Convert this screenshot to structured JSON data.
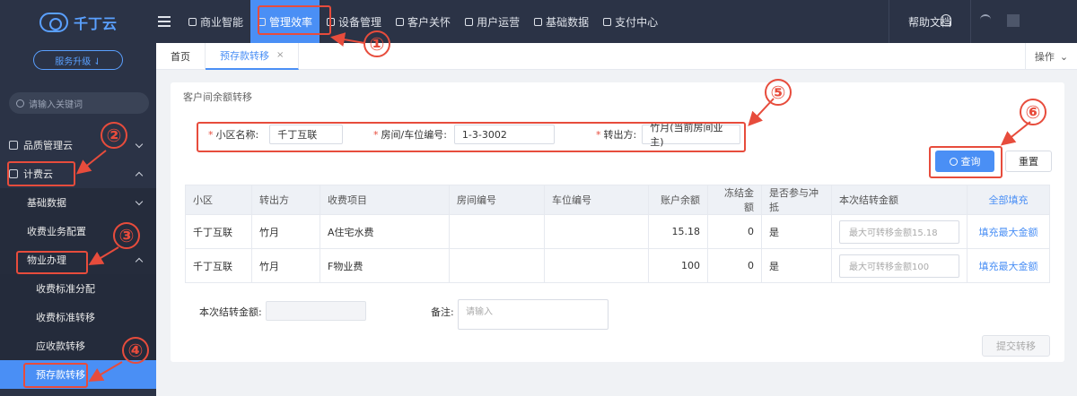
{
  "app": {
    "logo_text": "千丁云",
    "upgrade_label": "服务升级 ⇃"
  },
  "sidebar": {
    "search_placeholder": "请输入关键词",
    "items": [
      {
        "label": "品质管理云",
        "level": 1
      },
      {
        "label": "计费云",
        "level": 1
      },
      {
        "label": "基础数据",
        "level": 2
      },
      {
        "label": "收费业务配置",
        "level": 2
      },
      {
        "label": "物业办理",
        "level": 2
      },
      {
        "label": "收费标准分配",
        "level": 3
      },
      {
        "label": "收费标准转移",
        "level": 3
      },
      {
        "label": "应收款转移",
        "level": 3
      },
      {
        "label": "预存款转移",
        "level": 3,
        "active": true
      }
    ]
  },
  "topnav": {
    "items": [
      "商业智能",
      "管理效率",
      "设备管理",
      "客户关怀",
      "用户运营",
      "基础数据",
      "支付中心"
    ],
    "active": "管理效率",
    "help": "帮助文档"
  },
  "tabs": {
    "home": "首页",
    "current": "预存款转移",
    "close": "×",
    "ops": "操作"
  },
  "panel": {
    "title": "客户间余额转移",
    "form": {
      "community_label": "小区名称:",
      "community_value": "千丁互联",
      "room_label": "房间/车位编号:",
      "room_value": "1-3-3002",
      "from_label": "转出方:",
      "from_value": "竹月(当前房间业主)"
    },
    "query_label": "查询",
    "reset_label": "重置",
    "table": {
      "headers": [
        "小区",
        "转出方",
        "收费项目",
        "房间编号",
        "车位编号",
        "账户余额",
        "冻结金额",
        "是否参与冲抵",
        "本次结转金额",
        "全部填充"
      ],
      "rows": [
        [
          "千丁互联",
          "竹月",
          "A住宅水费",
          "",
          "",
          "15.18",
          "0",
          "是",
          "最大可转移金额15.18",
          "填充最大金额"
        ],
        [
          "千丁互联",
          "竹月",
          "F物业费",
          "",
          "",
          "100",
          "0",
          "是",
          "最大可转移金额100",
          "填充最大金额"
        ]
      ]
    },
    "amount_label": "本次结转金额:",
    "remark_label": "备注:",
    "remark_placeholder": "请输入",
    "submit_label": "提交转移"
  },
  "annotations": [
    "①",
    "②",
    "③",
    "④",
    "⑤",
    "⑥"
  ],
  "colors": {
    "accent": "#4a8ff5",
    "sidebar": "#2b3346",
    "annotation": "#e74c3c"
  }
}
